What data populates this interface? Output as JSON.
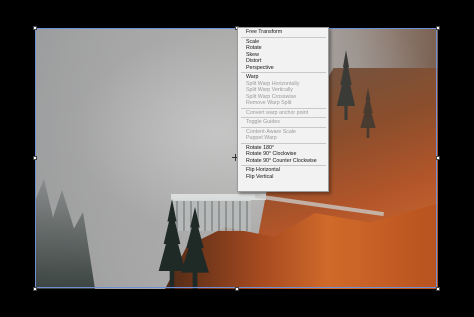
{
  "context_menu": {
    "groups": [
      {
        "items": [
          {
            "label": "Free Transform",
            "enabled": true
          }
        ]
      },
      {
        "items": [
          {
            "label": "Scale",
            "enabled": true
          },
          {
            "label": "Rotate",
            "enabled": true
          },
          {
            "label": "Skew",
            "enabled": true
          },
          {
            "label": "Distort",
            "enabled": true
          },
          {
            "label": "Perspective",
            "enabled": true
          }
        ]
      },
      {
        "items": [
          {
            "label": "Warp",
            "enabled": true
          },
          {
            "label": "Split Warp Horizontally",
            "enabled": false
          },
          {
            "label": "Split Warp Vertically",
            "enabled": false
          },
          {
            "label": "Split Warp Crosswise",
            "enabled": false
          },
          {
            "label": "Remove Warp Split",
            "enabled": false
          }
        ]
      },
      {
        "items": [
          {
            "label": "Convert warp anchor point",
            "enabled": false
          }
        ]
      },
      {
        "items": [
          {
            "label": "Toggle Guides",
            "enabled": false
          }
        ]
      },
      {
        "items": [
          {
            "label": "Content-Aware Scale",
            "enabled": false
          },
          {
            "label": "Puppet Warp",
            "enabled": false
          }
        ]
      },
      {
        "items": [
          {
            "label": "Rotate 180°",
            "enabled": true
          },
          {
            "label": "Rotate 90° Clockwise",
            "enabled": true
          },
          {
            "label": "Rotate 90° Counter Clockwise",
            "enabled": true
          }
        ]
      },
      {
        "items": [
          {
            "label": "Flip Horizontal",
            "enabled": true
          },
          {
            "label": "Flip Vertical",
            "enabled": true
          }
        ]
      }
    ]
  },
  "colors": {
    "background": "#000000",
    "menu_bg": "#f2f2f2",
    "menu_text": "#111111",
    "menu_disabled_text": "#9a9a9a",
    "transform_frame": "#6f8fd9"
  },
  "icons": [
    "transform-handle",
    "reference-point-crosshair-icon"
  ]
}
